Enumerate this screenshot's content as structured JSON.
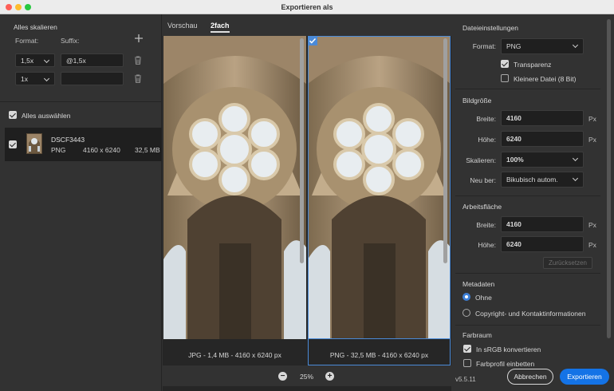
{
  "window": {
    "title": "Exportieren als"
  },
  "left": {
    "scale_all_title": "Alles skalieren",
    "format_label": "Format:",
    "suffix_label": "Suffix:",
    "add_icon": "plus-icon",
    "rows": [
      {
        "scale": "1,5x",
        "suffix": "@1,5x"
      },
      {
        "scale": "1x",
        "suffix": ""
      }
    ],
    "select_all": "Alles auswählen",
    "asset": {
      "name": "DSCF3443",
      "format": "PNG",
      "dims": "4160 x 6240",
      "size": "32,5 MB"
    }
  },
  "center": {
    "tabs": [
      "Vorschau",
      "2fach"
    ],
    "active_tab": 1,
    "previews": [
      {
        "caption": "JPG - 1,4 MB - 4160 x 6240 px"
      },
      {
        "caption": "PNG - 32,5 MB - 4160 x 6240 px"
      }
    ],
    "zoom": "25%"
  },
  "right": {
    "file_settings": {
      "title": "Dateieinstellungen",
      "format_label": "Format:",
      "format_value": "PNG",
      "transparency": "Transparenz",
      "smaller_file": "Kleinere Datei (8 Bit)"
    },
    "image_size": {
      "title": "Bildgröße",
      "width_label": "Breite:",
      "width_value": "4160",
      "height_label": "Höhe:",
      "height_value": "6240",
      "unit": "Px",
      "scale_label": "Skalieren:",
      "scale_value": "100%",
      "resample_label": "Neu ber:",
      "resample_value": "Bikubisch autom."
    },
    "canvas": {
      "title": "Arbeitsfläche",
      "width_label": "Breite:",
      "width_value": "4160",
      "height_label": "Höhe:",
      "height_value": "6240",
      "unit": "Px",
      "reset": "Zurücksetzen"
    },
    "metadata": {
      "title": "Metadaten",
      "none": "Ohne",
      "copyright": "Copyright- und Kontaktinformationen"
    },
    "color_space": {
      "title": "Farbraum",
      "convert_srgb": "In sRGB konvertieren",
      "embed_profile": "Farbprofil einbetten"
    }
  },
  "footer": {
    "version": "v5.5.11",
    "cancel": "Abbrechen",
    "export": "Exportieren"
  },
  "colors": {
    "accent": "#1473e6",
    "selection": "#4a8ad8"
  }
}
